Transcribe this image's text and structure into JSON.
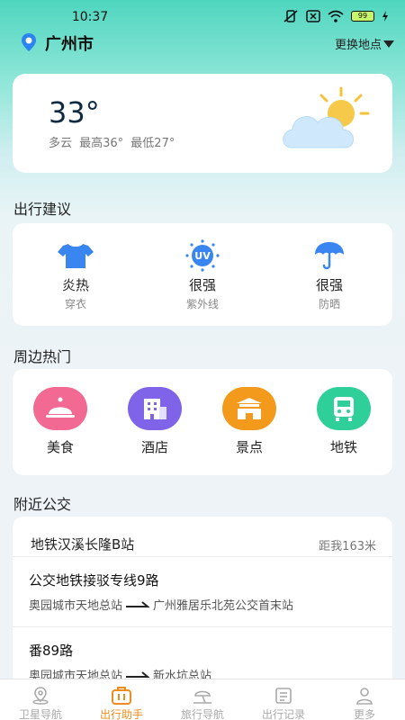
{
  "status": {
    "time": "10:37",
    "battery": "99"
  },
  "location": {
    "city": "广州市",
    "change_label": "更换地点"
  },
  "weather": {
    "temp": "33°",
    "desc": "多云  最高36°  最低27°"
  },
  "advice": {
    "title": "出行建议",
    "items": [
      {
        "value": "炎热",
        "label": "穿衣",
        "icon": "tshirt-icon"
      },
      {
        "value": "很强",
        "label": "紫外线",
        "icon": "uv-icon",
        "icon_text": "UV"
      },
      {
        "value": "很强",
        "label": "防晒",
        "icon": "umbrella-icon"
      }
    ]
  },
  "nearby_hot": {
    "title": "周边热门",
    "items": [
      {
        "label": "美食",
        "icon": "food-cloche-icon",
        "color": "#f26a93"
      },
      {
        "label": "酒店",
        "icon": "hotel-icon",
        "color": "#7f63e8"
      },
      {
        "label": "景点",
        "icon": "attraction-gate-icon",
        "color": "#f39a1c"
      },
      {
        "label": "地铁",
        "icon": "metro-icon",
        "color": "#2fcf9a"
      }
    ]
  },
  "bus": {
    "title": "附近公交",
    "station": "地铁汉溪长隆B站",
    "distance": "距我163米",
    "routes": [
      {
        "name": "公交地铁接驳专线9路",
        "from": "奥园城市天地总站",
        "to": "广州雅居乐北苑公交首末站"
      },
      {
        "name": "番89路",
        "from": "奥园城市天地总站",
        "to": "新水坑总站"
      }
    ]
  },
  "tabs": [
    {
      "label": "卫星导航",
      "icon": "satellite-nav-icon",
      "active": false
    },
    {
      "label": "出行助手",
      "icon": "suitcase-icon",
      "active": true
    },
    {
      "label": "旅行导航",
      "icon": "travel-icon",
      "active": false
    },
    {
      "label": "出行记录",
      "icon": "record-icon",
      "active": false
    },
    {
      "label": "更多",
      "icon": "profile-icon",
      "active": false
    }
  ]
}
